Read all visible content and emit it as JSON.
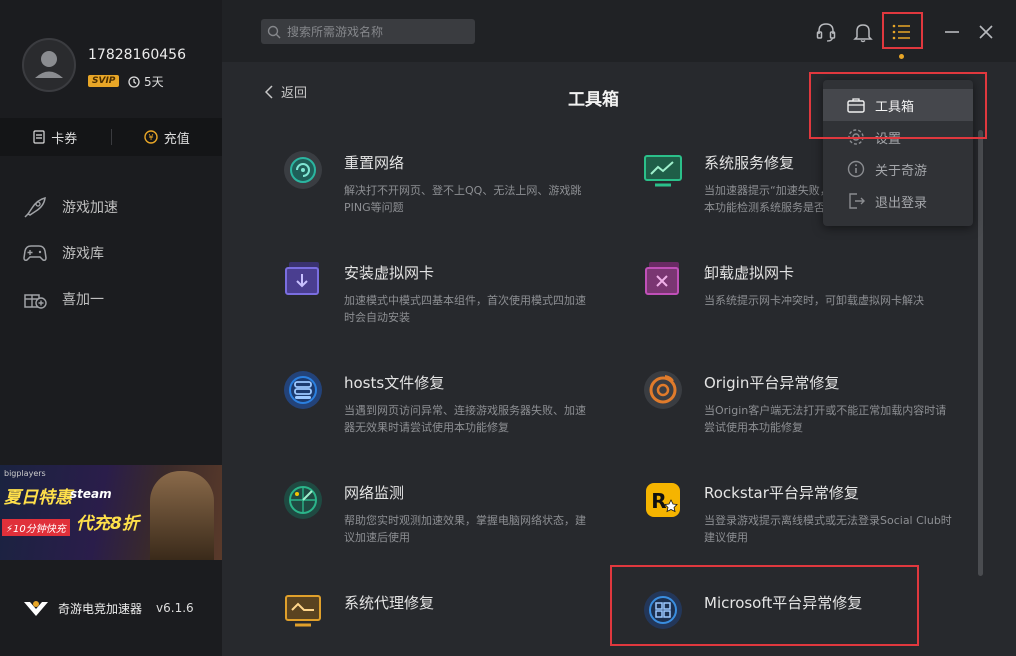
{
  "user": {
    "phone": "17828160456",
    "vip_badge": "SVIP",
    "days": "5天"
  },
  "sidebar": {
    "coupon_label": "卡券",
    "recharge_label": "充值",
    "nav": [
      {
        "label": "游戏加速",
        "icon": "rocket-icon"
      },
      {
        "label": "游戏库",
        "icon": "gamepad-icon"
      },
      {
        "label": "喜加一",
        "icon": "gift-add-icon"
      }
    ],
    "banner": {
      "brand": "bigplayers",
      "headline": "夏日特惠",
      "steam": "steam",
      "discount": "代充8折",
      "tag": "⚡10分钟快充"
    },
    "app_name": "奇游电竞加速器",
    "version": "v6.1.6"
  },
  "header": {
    "search_placeholder": "搜索所需游戏名称"
  },
  "toolbox": {
    "back_label": "返回",
    "title": "工具箱",
    "tools": [
      {
        "name": "重置网络",
        "desc": "解决打不开网页、登不上QQ、无法上网、游戏跳PING等问题",
        "icon": "reset-network-icon",
        "color": "#2bb5a0"
      },
      {
        "name": "系统服务修复",
        "desc": "当加速器提示“加速失败，错误码100”时，可使用本功能检测系统服务是否",
        "icon": "system-service-icon",
        "color": "#2bc08a"
      },
      {
        "name": "安装虚拟网卡",
        "desc": "加速模式中模式四基本组件，首次使用模式四加速时会自动安装",
        "icon": "install-adapter-icon",
        "color": "#7a6ee0"
      },
      {
        "name": "卸载虚拟网卡",
        "desc": "当系统提示网卡冲突时，可卸载虚拟网卡解决",
        "icon": "uninstall-adapter-icon",
        "color": "#c050b8"
      },
      {
        "name": "hosts文件修复",
        "desc": "当遇到网页访问异常、连接游戏服务器失败、加速器无效果时请尝试使用本功能修复",
        "icon": "hosts-file-icon",
        "color": "#2b80e0"
      },
      {
        "name": "Origin平台异常修复",
        "desc": "当Origin客户端无法打开或不能正常加载内容时请尝试使用本功能修复",
        "icon": "origin-icon",
        "color": "#e07b2b"
      },
      {
        "name": "网络监测",
        "desc": "帮助您实时观测加速效果，掌握电脑网络状态，建议加速后使用",
        "icon": "network-monitor-icon",
        "color": "#2bb58a"
      },
      {
        "name": "Rockstar平台异常修复",
        "desc": "当登录游戏提示离线模式或无法登录Social Club时建议使用",
        "icon": "rockstar-icon",
        "color": "#f5b400"
      },
      {
        "name": "系统代理修复",
        "desc": "",
        "icon": "proxy-fix-icon",
        "color": "#e0a02b"
      },
      {
        "name": "Microsoft平台异常修复",
        "desc": "",
        "icon": "microsoft-icon",
        "color": "#3a8ee0"
      }
    ]
  },
  "menu": {
    "items": [
      {
        "label": "工具箱",
        "icon": "toolbox-icon",
        "active": true
      },
      {
        "label": "设置",
        "icon": "gear-icon",
        "active": false
      },
      {
        "label": "关于奇游",
        "icon": "info-icon",
        "active": false
      },
      {
        "label": "退出登录",
        "icon": "logout-icon",
        "active": false
      }
    ]
  },
  "colors": {
    "accent": "#e8a627",
    "highlight_border": "#e0383e",
    "sidebar_bg": "#1b1c1f",
    "main_bg": "#27292d"
  }
}
